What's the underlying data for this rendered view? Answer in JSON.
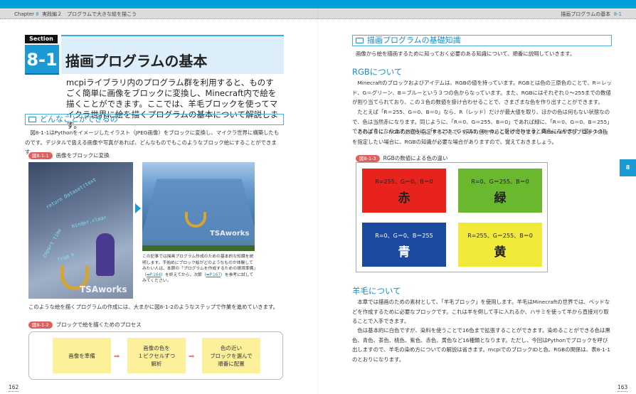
{
  "header": {
    "chapter_label": "Chapter",
    "chapter_num": "8",
    "chapter_title": "実践編２　プログラムで大きな絵を描こう",
    "right_title": "描画プログラムの基本",
    "right_section": "8-1"
  },
  "left": {
    "section_label": "Section",
    "section_num": "8-1",
    "title": "描画プログラムの基本",
    "intro": "mcpiライブラリ内のプログラム群を利用すると、ものすごく簡単に画像をブロックに変換し、Minecraft内で絵を描くことができます。ここでは、羊毛ブロックを使ってマイクラ世界に絵を描くプログラムの基本について解説します。",
    "heading1": "どんなことができるの",
    "body1": "図8-1-1はPythonをイメージしたイラスト（JPEG画像）をブロックに変換し、マイクラ世界に構築したものです。デジタルで扱える画像や写真があれば、どんなものでもこのようなブロック絵にすることができます。",
    "fig1_tag": "図8-1-1",
    "fig1_caption": "画像をブロックに変換",
    "image_watermark": "TSAworks",
    "note_pre": "この記事では描画プログラム作成のための基本的な知識を説明します。手始めにブロック絵がどのようなものか体験してみたい人は、本節の「プログラムを作成するための環境準備」（",
    "note_link1": "➡P.164",
    "note_mid": "）を終えてから、次節（",
    "note_link2": "➡P.167",
    "note_post": "）を参考に試してみてください。",
    "body2": "このような絵を描くプログラムの作成には、大まかに図8-1-2のようなステップで作業を進めていきます。",
    "fig2_tag": "図8-1-2",
    "fig2_caption": "ブロックで絵を描くためのプロセス",
    "steps": [
      "画像を準備",
      "画像の色を\n１ピクセルずつ\n解析",
      "色の近い\nブロックを選んで\n順番に配置"
    ],
    "page_number": "162"
  },
  "right": {
    "heading1": "描画プログラムの基礎知識",
    "lead": "画像から絵を描画するために知っておく必要のある知識について、順番に説明していきます。",
    "h_rgb": "RGBについて",
    "rgb_p1": "Minecraftのブロックおよびアイテムは、RGBの値を持っています。RGBとは色の三原色のことで、R＝レッド、G＝グリーン、B＝ブルーという３つの色からなっています。また、RGBにはそれぞれ０～255までの数値が割り当てられており、この３色の数値を掛け合わせることで、さまざまな色を作り出すことができます。",
    "rgb_p2": "たとえば「R＝255、G＝0、B＝0」なら、R（レッド）だけが最大値を取り、ほかの色は何もない状態なので、色は当然赤になります。同じように、「R＝0、G＝255、B＝0」であれば緑に、「R＝0、G＝0、B＝255」であれば青になります。さらに、「R＝255、G＝255、B＝0」と掛け合わせると黄色になります（図8-1-3）。",
    "rgb_p3": "このように、RGBの数値を指定することで、好みの色を作ることができます。Minecraftでもブロックの色を指定したい場合に、RGBの知識が必要な場合がありますので、覚えておきましょう。",
    "fig3_tag": "図8-1-3",
    "fig3_caption": "RGBの数値による色の違い",
    "colors": [
      {
        "value": "R=255、G＝0、B＝0",
        "name": "赤",
        "bg": "#e8221c",
        "fg": "#222"
      },
      {
        "value": "R=0、G＝255、B＝0",
        "name": "緑",
        "bg": "#6ab82e",
        "fg": "#222"
      },
      {
        "value": "R=0、G＝0、B＝255",
        "name": "青",
        "bg": "#1b4aa0",
        "fg": "#fff"
      },
      {
        "value": "R=255、G＝255、B＝0",
        "name": "黄",
        "bg": "#f2ea3a",
        "fg": "#222"
      }
    ],
    "h_wool": "羊毛について",
    "wool_p1": "本章では描画のための素材として、「羊毛ブロック」を使用します。羊毛はMinecraftの世界では、ベッドなどを作成するために必要なブロックです。これは羊を倒して手に入れるか、ハサミを使って羊から直接刈り取ることで入手できます。",
    "wool_p2": "色は基本的に白色ですが、染料を使うことで16色まで拡張することができます。染めることができる色は黒色、青色、茶色、桃色、紫色、赤色、黄色など16種類となります。ただし、今回はPythonでブロックを呼び出しますので、羊毛の染め方についての解説は省きます。mcpiでのブロックIDと色、RGBの関係は、表8-1-1のとおりになります。",
    "side_tab": "8",
    "page_number": "163"
  }
}
